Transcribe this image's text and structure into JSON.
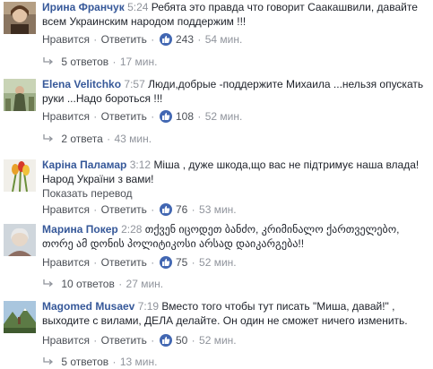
{
  "comments": [
    {
      "author": "Ирина Франчук",
      "time": "5:24",
      "text": "Ребята это правда что говорит Саакашвили, давайте всем Украинским народом поддержим !!!",
      "like": "Нравится",
      "reply": "Ответить",
      "likes": "243",
      "ago": "54 мин.",
      "replies": "5 ответов",
      "replies_ago": "17 мин."
    },
    {
      "author": "Elena Velitchko",
      "time": "7:57",
      "text": "Люди,добрые -поддержите Михаила ...нельзя опускать руки ...Надо бороться !!!",
      "like": "Нравится",
      "reply": "Ответить",
      "likes": "108",
      "ago": "52 мин.",
      "replies": "2 ответа",
      "replies_ago": "43 мин."
    },
    {
      "author": "Каріна Паламар",
      "time": "3:12",
      "text": "Міша , дуже шкода,що вас не підтримує наша влада! Народ України з вами!",
      "translate": "Показать перевод",
      "like": "Нравится",
      "reply": "Ответить",
      "likes": "76",
      "ago": "53 мин."
    },
    {
      "author": "Марина Покер",
      "time": "2:28",
      "text": "თქვენ იცოდეთ ბანძო, კრიმინალო ქართველებო, თორე ამ დონის პოლიტიკოსი არსად დაიკარგება!!",
      "like": "Нравится",
      "reply": "Ответить",
      "likes": "75",
      "ago": "52 мин.",
      "replies": "10 ответов",
      "replies_ago": "27 мин."
    },
    {
      "author": "Magomed Musaev",
      "time": "7:19",
      "text": "Вместо того чтобы тут писать \"Миша, давай!\" , выходите с вилами, ДЕЛА делайте. Он один не сможет ничего изменить.",
      "like": "Нравится",
      "reply": "Ответить",
      "likes": "50",
      "ago": "52 мин.",
      "replies": "5 ответов",
      "replies_ago": "13 мин."
    }
  ],
  "colors": {
    "link": "#365899",
    "meta": "#90949c",
    "like_badge": "#4267b2"
  },
  "icons": {
    "like": "thumbs-up-icon",
    "reply": "reply-arrow-icon"
  }
}
